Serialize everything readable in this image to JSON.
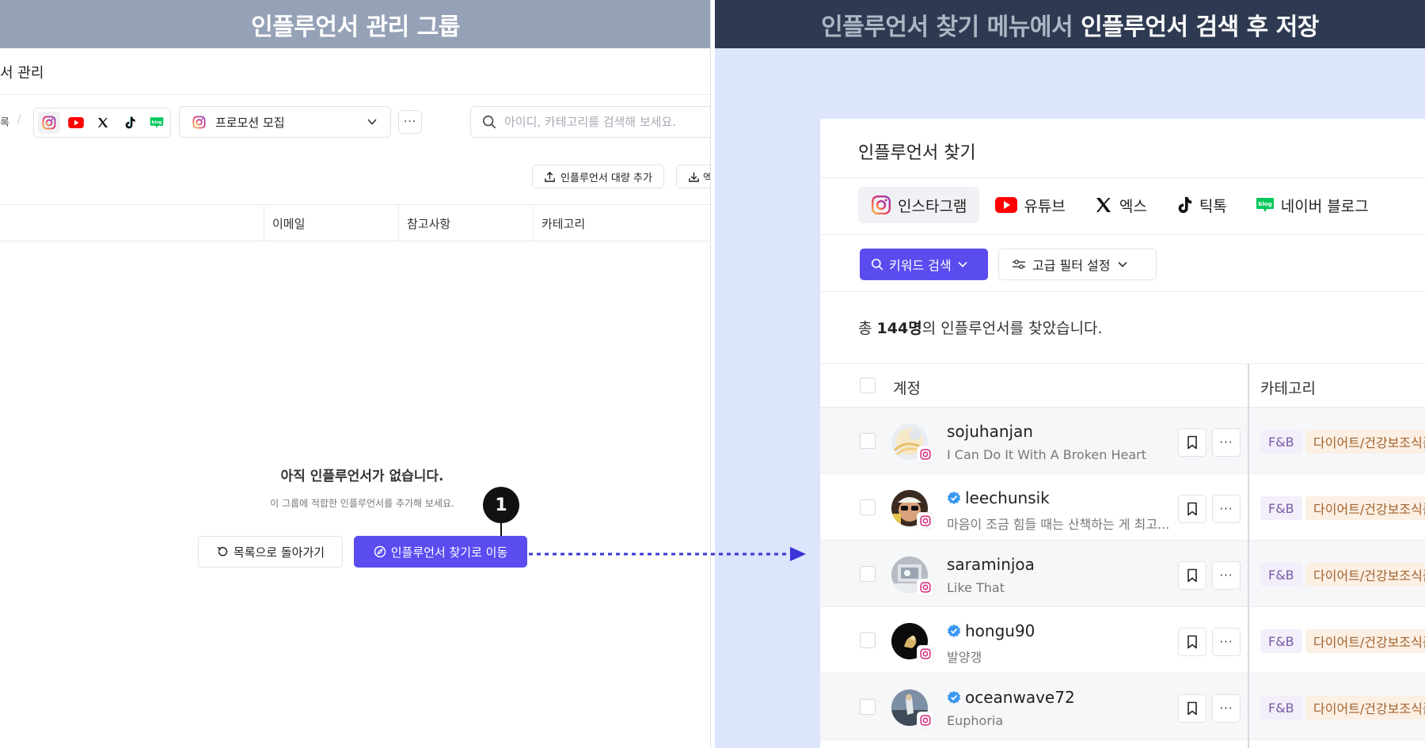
{
  "left": {
    "banner": "인플루언서 관리 그룹",
    "page_title": "서 관리",
    "breadcrumb": "록",
    "platform_icons": [
      "instagram-icon",
      "youtube-icon",
      "x-icon",
      "tiktok-icon",
      "naver-blog-icon"
    ],
    "group_select": {
      "value": "프로모션 모집"
    },
    "more_label": "···",
    "search": {
      "placeholder": "아이디, 카테고리를 검색해 보세요."
    },
    "bulk_add_label": "인플루언서 대량 추가",
    "download_label": "엑",
    "columns": [
      "이메일",
      "참고사항",
      "카테고리"
    ],
    "empty_title": "아직 인플루언서가 없습니다.",
    "empty_sub": "이 그룹에 적합한 인플루언서를 추가해 보세요.",
    "back_button": "목록으로 돌아가기",
    "go_button": "인플루언서 찾기로 이동",
    "step_number": "1"
  },
  "right": {
    "banner_dim": "인플루언서 찾기 메뉴에서",
    "banner_bright": "인플루언서 검색 후 저장",
    "card_title": "인플루언서 찾기",
    "tabs": [
      {
        "label": "인스타그램",
        "icon": "instagram-icon",
        "active": true
      },
      {
        "label": "유튜브",
        "icon": "youtube-icon",
        "active": false
      },
      {
        "label": "엑스",
        "icon": "x-icon",
        "active": false
      },
      {
        "label": "틱톡",
        "icon": "tiktok-icon",
        "active": false
      },
      {
        "label": "네이버 블로그",
        "icon": "naver-blog-icon",
        "active": false
      }
    ],
    "keyword_button": "키워드 검색",
    "filter_button": "고급 필터 설정",
    "count_prefix": "총 ",
    "count_value": "144명",
    "count_suffix": "의 인플루언서를 찾았습니다.",
    "list_header_account": "계정",
    "list_header_category": "카테고리",
    "rows": [
      {
        "name": "sojuhanjan",
        "verified": false,
        "bio": "I Can Do It With A Broken Heart",
        "tag1": "F&B",
        "tag2": "다이어트/건강보조식품"
      },
      {
        "name": "leechunsik",
        "verified": true,
        "bio": "마음이 조금 힘들 때는 산책하는 게 최고...",
        "tag1": "F&B",
        "tag2": "다이어트/건강보조식품"
      },
      {
        "name": "saraminjoa",
        "verified": false,
        "bio": "Like That",
        "tag1": "F&B",
        "tag2": "다이어트/건강보조식품"
      },
      {
        "name": "hongu90",
        "verified": true,
        "bio": "발양갱",
        "tag1": "F&B",
        "tag2": "다이어트/건강보조식품"
      },
      {
        "name": "oceanwave72",
        "verified": true,
        "bio": "Euphoria",
        "tag1": "F&B",
        "tag2": "다이어트/건강보조식품"
      }
    ]
  },
  "colors": {
    "left_banner": "#95a1b6",
    "right_banner": "#2e3a51",
    "accent": "#5b4cf0",
    "right_bg": "#dce5fb"
  }
}
